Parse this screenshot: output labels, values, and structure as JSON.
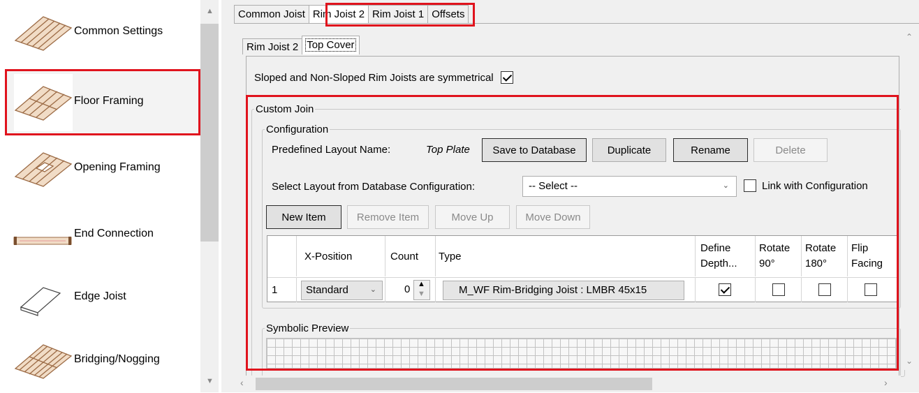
{
  "sidebar": {
    "items": [
      {
        "label": "Common Settings",
        "icon": "floor-boards-icon"
      },
      {
        "label": "Floor Framing",
        "icon": "floor-framing-icon",
        "selected": true
      },
      {
        "label": "Opening Framing",
        "icon": "opening-framing-icon"
      },
      {
        "label": "End Connection",
        "icon": "end-connection-icon"
      },
      {
        "label": "Edge Joist",
        "icon": "edge-joist-icon"
      },
      {
        "label": "Bridging/Nogging",
        "icon": "bridging-nogging-icon"
      }
    ]
  },
  "top_tabs": [
    {
      "label": "Common Joist"
    },
    {
      "label": "Rim Joist 2",
      "active": true
    },
    {
      "label": "Rim Joist 1"
    },
    {
      "label": "Offsets"
    }
  ],
  "sub_tabs": [
    {
      "label": "Rim Joist 2"
    },
    {
      "label": "Top Cover",
      "active": true
    }
  ],
  "symmetric": {
    "label": "Sloped and Non-Sloped Rim Joists are symmetrical",
    "checked": true
  },
  "custom_join": {
    "legend": "Custom Join",
    "configuration": {
      "legend": "Configuration",
      "predefined_label": "Predefined Layout Name:",
      "predefined_value": "Top Plate",
      "buttons": {
        "save": "Save to Database",
        "duplicate": "Duplicate",
        "rename": "Rename",
        "delete": "Delete"
      },
      "select_label": "Select Layout from Database Configuration:",
      "select_value": "-- Select --",
      "link_label": "Link with Configuration",
      "link_checked": false,
      "item_buttons": {
        "new": "New Item",
        "remove": "Remove Item",
        "up": "Move Up",
        "down": "Move Down"
      },
      "table": {
        "headers": {
          "xpos": "X-Position",
          "count": "Count",
          "type": "Type",
          "define1": "Define",
          "define2": "Depth...",
          "rot90_1": "Rotate",
          "rot90_2": "90°",
          "rot180_1": "Rotate",
          "rot180_2": "180°",
          "flip1": "Flip",
          "flip2": "Facing"
        },
        "rows": [
          {
            "num": "1",
            "xpos": "Standard",
            "count": "0",
            "type": "M_WF Rim-Bridging Joist : LMBR 45x15",
            "define_depth": true,
            "rotate90": false,
            "rotate180": false,
            "flip": false
          }
        ]
      }
    },
    "preview_legend": "Symbolic Preview"
  },
  "colors": {
    "highlight": "#e0131d",
    "wood": "#b8825a"
  }
}
